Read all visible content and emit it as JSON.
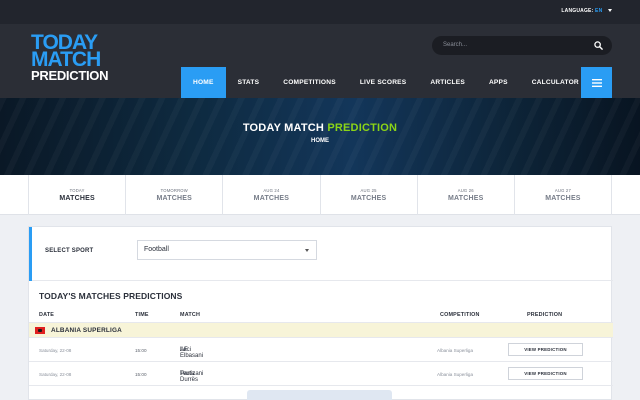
{
  "top_bar": {
    "language_label": "LANGUAGE:",
    "language_code": "EN"
  },
  "logo": {
    "line1": "TODAY",
    "line2": "MATCH",
    "line3": "PREDICTION"
  },
  "search": {
    "placeholder": "Search..."
  },
  "nav": {
    "items": [
      {
        "label": "HOME",
        "active": true
      },
      {
        "label": "STATS"
      },
      {
        "label": "COMPETITIONS"
      },
      {
        "label": "LIVE SCORES"
      },
      {
        "label": "ARTICLES"
      },
      {
        "label": "APPS"
      },
      {
        "label": "CALCULATOR"
      }
    ]
  },
  "banner": {
    "title_part1": "TODAY MATCH",
    "title_part2": "PREDICTION",
    "breadcrumb": "HOME"
  },
  "date_tabs": [
    {
      "day": "TODAY",
      "label": "MATCHES"
    },
    {
      "day": "TOMORROW",
      "label": "MATCHES"
    },
    {
      "day": "AUG 24",
      "label": "MATCHES"
    },
    {
      "day": "AUG 25",
      "label": "MATCHES"
    },
    {
      "day": "AUG 26",
      "label": "MATCHES"
    },
    {
      "day": "AUG 27",
      "label": "MATCHES"
    }
  ],
  "sport_select": {
    "label": "SELECT SPORT",
    "value": "Football"
  },
  "section_title": "TODAY'S MATCHES PREDICTIONS",
  "table": {
    "headers": {
      "date": "DATE",
      "time": "TIME",
      "match": "MATCH",
      "competition": "COMPETITION",
      "prediction": "PREDICTION"
    },
    "league": {
      "name": "ALBANIA SUPERLIGA"
    },
    "rows": [
      {
        "date": "Saturday, 22-08",
        "time": "15:00",
        "home": "Laci",
        "vs": "vs",
        "away": "AF Elbasani",
        "competition": "Albania Superliga",
        "button": "VIEW PREDICTION"
      },
      {
        "date": "Saturday, 22-08",
        "time": "15:00",
        "home": "Partizani",
        "vs": "vs",
        "away": "Teuta Durrës",
        "competition": "Albania Superliga",
        "button": "VIEW PREDICTION"
      }
    ]
  },
  "colors": {
    "accent": "#2a9df4",
    "highlight": "#8bd417",
    "header_bg": "#2b2e36",
    "topbar_bg": "#22252d",
    "league_bg": "#f7f4d8"
  }
}
